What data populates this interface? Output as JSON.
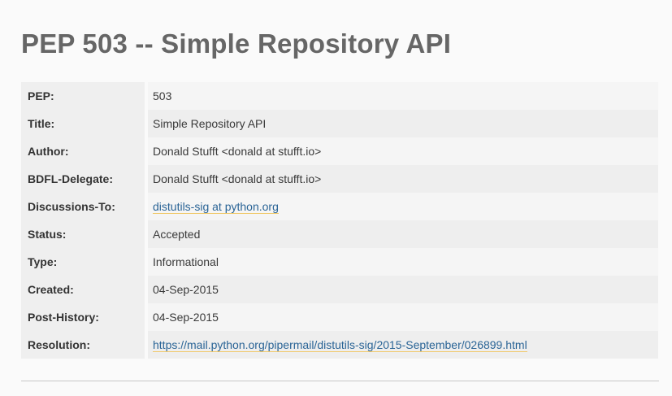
{
  "title": "PEP 503 -- Simple Repository API",
  "metadata": [
    {
      "field": "PEP:",
      "value": "503",
      "link": false
    },
    {
      "field": "Title:",
      "value": "Simple Repository API",
      "link": false
    },
    {
      "field": "Author:",
      "value": "Donald Stufft <donald at stufft.io>",
      "link": false
    },
    {
      "field": "BDFL-Delegate:",
      "value": "Donald Stufft <donald at stufft.io>",
      "link": false
    },
    {
      "field": "Discussions-To:",
      "value": "distutils-sig at python.org",
      "link": true
    },
    {
      "field": "Status:",
      "value": "Accepted",
      "link": false
    },
    {
      "field": "Type:",
      "value": "Informational",
      "link": false
    },
    {
      "field": "Created:",
      "value": "04-Sep-2015",
      "link": false
    },
    {
      "field": "Post-History:",
      "value": "04-Sep-2015",
      "link": false
    },
    {
      "field": "Resolution:",
      "value": "https://mail.python.org/pipermail/distutils-sig/2015-September/026899.html",
      "link": true
    }
  ],
  "colors": {
    "link": "#2a6496",
    "link_underline": "#f0c96a",
    "title": "#666666"
  }
}
